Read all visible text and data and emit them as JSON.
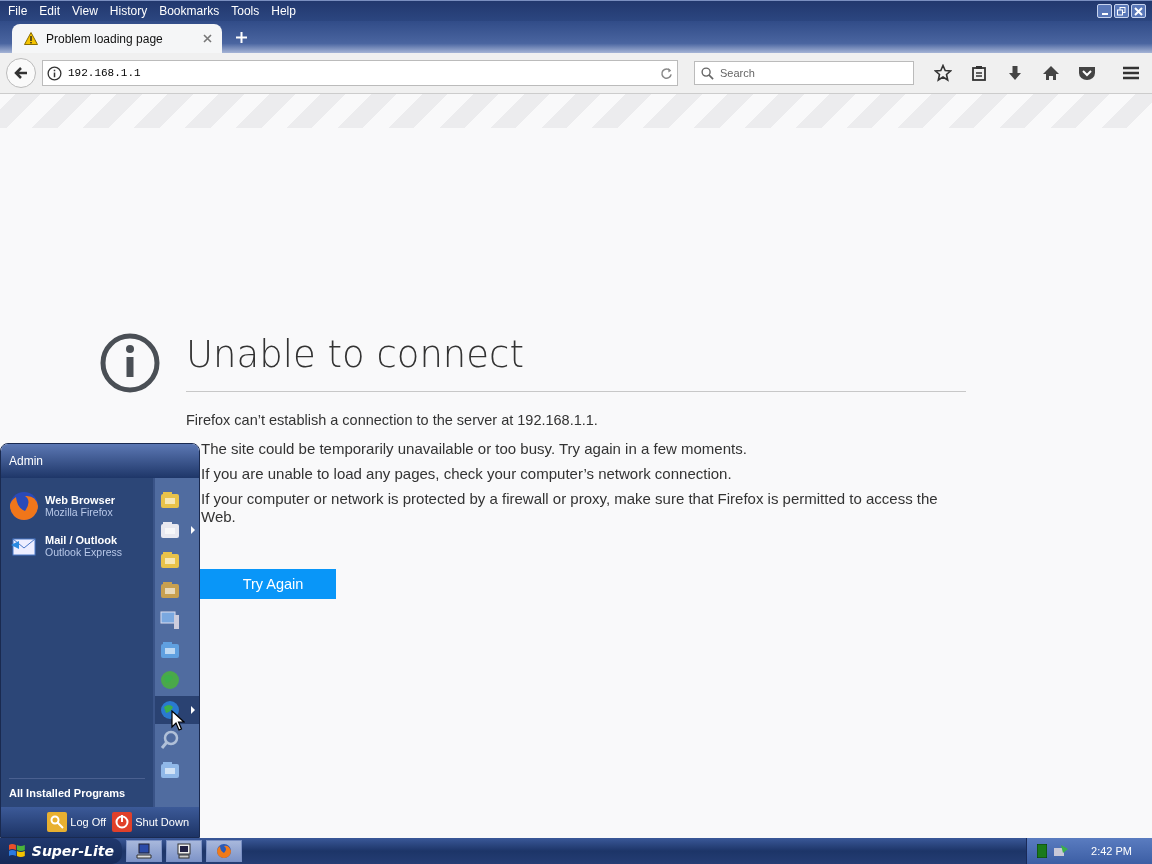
{
  "menu_bar": [
    "File",
    "Edit",
    "View",
    "History",
    "Bookmarks",
    "Tools",
    "Help"
  ],
  "tabs": [
    {
      "title": "Problem loading page",
      "selected": true
    }
  ],
  "address_bar": {
    "value": "192.168.1.1"
  },
  "search": {
    "placeholder": "Search"
  },
  "error_page": {
    "title": "Unable to connect",
    "message": "Firefox can’t establish a connection to the server at 192.168.1.1.",
    "suggestions": [
      "The site could be temporarily unavailable or too busy. Try again in a few moments.",
      "If you are unable to load any pages, check your computer’s network connection.",
      "If your computer or network is protected by a firewall or proxy, make sure that Firefox is permitted to access the Web."
    ],
    "button": "Try Again"
  },
  "start_menu": {
    "user": "Admin",
    "programs": [
      {
        "name": "Web Browser",
        "subtitle": "Mozilla Firefox"
      },
      {
        "name": "Mail / Outlook",
        "subtitle": "Outlook Express"
      }
    ],
    "all_programs": "All Installed Programs",
    "places": [
      {
        "selected": false,
        "submenu": false
      },
      {
        "selected": false,
        "submenu": true
      },
      {
        "selected": false,
        "submenu": false
      },
      {
        "selected": false,
        "submenu": false
      },
      {
        "selected": false,
        "submenu": false
      },
      {
        "selected": false,
        "submenu": false
      },
      {
        "selected": false,
        "submenu": false
      },
      {
        "selected": true,
        "submenu": true
      },
      {
        "selected": false,
        "submenu": false
      },
      {
        "selected": false,
        "submenu": false
      }
    ],
    "log_off": "Log Off",
    "shut_down": "Shut Down"
  },
  "taskbar": {
    "start": "Super-Lite",
    "clock": "2:42 PM"
  }
}
